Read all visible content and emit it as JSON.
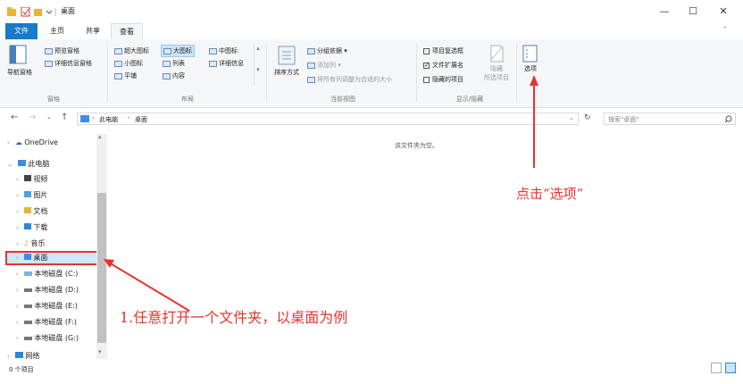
{
  "window": {
    "title": "桌面",
    "minimize": "—",
    "maximize": "☐",
    "close": "✕"
  },
  "tabs": [
    "文件",
    "主页",
    "共享",
    "查看"
  ],
  "ribbon": {
    "panes": {
      "nav_pane": "导航窗格",
      "preview_pane": "预览窗格",
      "details_pane": "详细信息窗格",
      "group_label": "窗格"
    },
    "layout": {
      "items": [
        "超大图标",
        "大图标",
        "中图标",
        "小图标",
        "列表",
        "详细信息",
        "平铺",
        "内容"
      ],
      "group_label": "布局"
    },
    "current_view": {
      "sort_by": "排序方式",
      "group_by": "分组依据",
      "add_column": "添加列",
      "fit_columns": "将所有列调整为合适的大小",
      "group_label": "当前视图"
    },
    "show_hide": {
      "item_checkboxes": "项目复选框",
      "file_extensions": "文件扩展名",
      "hidden_items": "隐藏的项目",
      "hide_selected_1": "隐藏",
      "hide_selected_2": "所选项目",
      "group_label": "显示/隐藏"
    },
    "options": "选项"
  },
  "address": {
    "path_1": "此电脑",
    "path_2": "桌面",
    "search_placeholder": "搜索\"桌面\""
  },
  "sidebar": {
    "items": [
      "OneDrive",
      "此电脑",
      "视频",
      "图片",
      "文档",
      "下载",
      "音乐",
      "桌面",
      "本地磁盘 (C:)",
      "本地磁盘 (D:)",
      "本地磁盘 (E:)",
      "本地磁盘 (F:)",
      "本地磁盘 (G:)",
      "网络"
    ]
  },
  "main": {
    "empty_text": "该文件夹为空。"
  },
  "status": {
    "count": "0 个项目"
  },
  "annotations": {
    "step2": "点击“选项”",
    "step1": "1.任意打开一个文件夹，以桌面为例"
  },
  "colors": {
    "accent": "#1979ca",
    "annotation_red": "#e8322e"
  }
}
